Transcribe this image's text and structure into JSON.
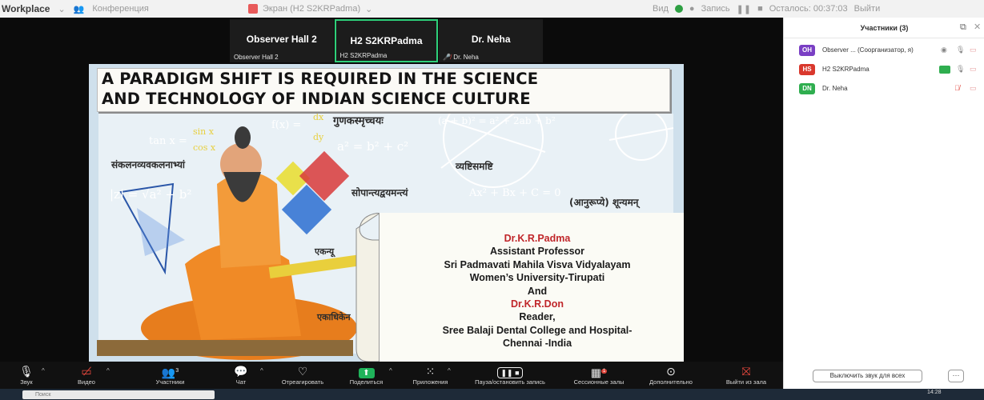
{
  "window": {
    "app_name": "Workplace",
    "conference_label": "Конференция",
    "screen_share_label": "Экран (H2 S2KRPadma)",
    "view_label": "Вид",
    "recording_label": "Запись",
    "time_remaining": "Осталось: 00:37:03",
    "end_label": "Выйти"
  },
  "tiles": [
    {
      "name": "Observer Hall 2",
      "sub": "Observer Hall 2",
      "active": false
    },
    {
      "name": "H2 S2KRPadma",
      "sub": "H2 S2KRPadma",
      "active": true
    },
    {
      "name": "Dr. Neha",
      "sub": "Dr. Neha",
      "active": false,
      "muted": true
    }
  ],
  "slide": {
    "title_line1": "A PARADIGM SHIFT IS REQUIRED IN THE SCIENCE",
    "title_line2": "AND TECHNOLOGY OF INDIAN SCIENCE CULTURE",
    "author1": "Dr.K.R.Padma",
    "line2": "Assistant Professor",
    "line3": "Sri Padmavati Mahila Visva Vidyalayam",
    "line4": "Women’s University-Tirupati",
    "line5": "And",
    "author2": "Dr.K.R.Don",
    "line7": "Reader,",
    "line8": "Sree Balaji Dental College and Hospital-",
    "line9": "Chennai -India",
    "board_text": {
      "t1": "गुणकस्मृच्चयः",
      "t2": "संकलनव्यवकलनाभ्यां",
      "t3": "व्यष्टिसमष्टि",
      "t4": "सोपान्त्यद्वयमन्त्यं",
      "t5": "(आनुरूप्ये) शून्यमन्",
      "t6": "एकन्यू",
      "t7": "एकाधिकेन",
      "f1": "tan x =",
      "f2": "f(x) =",
      "f3": "a² = b² + c²",
      "f4": "|z| = √a² + b²",
      "f5": "Ax² + Bx + C = 0",
      "f6": "(a + b)² = a² + 2ab + b²",
      "f7": "sin x",
      "f8": "cos x",
      "f9": "dx",
      "f10": "dy"
    }
  },
  "participants": {
    "title": "Участники (3)",
    "items": [
      {
        "initials": "OH",
        "name": "Observer ... (Соорганизатор, я)",
        "color": "#7a3fc4"
      },
      {
        "initials": "HS",
        "name": "H2 S2KRPadma",
        "color": "#d9382d"
      },
      {
        "initials": "DN",
        "name": "Dr. Neha",
        "color": "#2fae4f"
      }
    ],
    "mute_all": "Выключить звук для всех",
    "more": "···"
  },
  "toolbar": {
    "audio": "Звук",
    "video": "Видео",
    "participants": "Участники",
    "participants_count": "3",
    "chat": "Чат",
    "react": "Отреагировать",
    "share": "Поделиться",
    "apps": "Приложения",
    "pause_record": "Пауза/остановить запись",
    "breakout": "Сессионные залы",
    "breakout_badge": "1",
    "more": "Дополнительно",
    "leave": "Выйти из зала"
  },
  "taskbar": {
    "search": "Поиск",
    "clock": "14:28"
  }
}
